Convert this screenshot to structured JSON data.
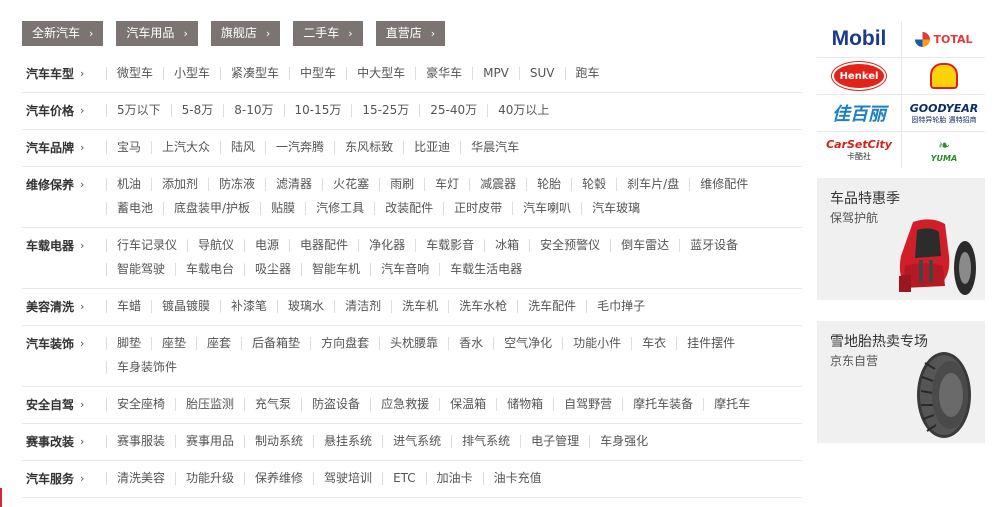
{
  "topnav": [
    {
      "label": "全新汽车"
    },
    {
      "label": "汽车用品"
    },
    {
      "label": "旗舰店"
    },
    {
      "label": "二手车"
    },
    {
      "label": "直营店"
    }
  ],
  "categories": [
    {
      "title": "汽车车型",
      "items": [
        "微型车",
        "小型车",
        "紧凑型车",
        "中型车",
        "中大型车",
        "豪华车",
        "MPV",
        "SUV",
        "跑车"
      ]
    },
    {
      "title": "汽车价格",
      "items": [
        "5万以下",
        "5-8万",
        "8-10万",
        "10-15万",
        "15-25万",
        "25-40万",
        "40万以上"
      ]
    },
    {
      "title": "汽车品牌",
      "items": [
        "宝马",
        "上汽大众",
        "陆风",
        "一汽奔腾",
        "东风标致",
        "比亚迪",
        "华晨汽车"
      ]
    },
    {
      "title": "维修保养",
      "items": [
        "机油",
        "添加剂",
        "防冻液",
        "滤清器",
        "火花塞",
        "雨刷",
        "车灯",
        "减震器",
        "轮胎",
        "轮毂",
        "刹车片/盘",
        "维修配件",
        "蓄电池",
        "底盘装甲/护板",
        "贴膜",
        "汽修工具",
        "改装配件",
        "正时皮带",
        "汽车喇叭",
        "汽车玻璃"
      ]
    },
    {
      "title": "车载电器",
      "items": [
        "行车记录仪",
        "导航仪",
        "电源",
        "电器配件",
        "净化器",
        "车载影音",
        "冰箱",
        "安全预警仪",
        "倒车雷达",
        "蓝牙设备",
        "智能驾驶",
        "车载电台",
        "吸尘器",
        "智能车机",
        "汽车音响",
        "车载生活电器"
      ]
    },
    {
      "title": "美容清洗",
      "items": [
        "车蜡",
        "镀晶镀膜",
        "补漆笔",
        "玻璃水",
        "清洁剂",
        "洗车机",
        "洗车水枪",
        "洗车配件",
        "毛巾掸子"
      ]
    },
    {
      "title": "汽车装饰",
      "items": [
        "脚垫",
        "座垫",
        "座套",
        "后备箱垫",
        "方向盘套",
        "头枕腰靠",
        "香水",
        "空气净化",
        "功能小件",
        "车衣",
        "挂件摆件",
        "车身装饰件"
      ]
    },
    {
      "title": "安全自驾",
      "items": [
        "安全座椅",
        "胎压监测",
        "充气泵",
        "防盗设备",
        "应急救援",
        "保温箱",
        "储物箱",
        "自驾野营",
        "摩托车装备",
        "摩托车"
      ]
    },
    {
      "title": "赛事改装",
      "items": [
        "赛事服装",
        "赛事用品",
        "制动系统",
        "悬挂系统",
        "进气系统",
        "排气系统",
        "电子管理",
        "车身强化"
      ]
    },
    {
      "title": "汽车服务",
      "items": [
        "清洗美容",
        "功能升级",
        "保养维修",
        "驾驶培训",
        "ETC",
        "加油卡",
        "油卡充值"
      ]
    }
  ],
  "brands": {
    "mobil": "Mobil",
    "total": "TOTAL",
    "henkel": "Henkel",
    "jiabaili": "佳百丽",
    "goodyear_en": "GOODYEAR",
    "goodyear_cn": "固特异轮胎 遇特招商",
    "carsetcity_en": "CarSetCity",
    "carsetcity_cn": "卡酷社",
    "yuma": "YUMA"
  },
  "promos": [
    {
      "title": "车品特惠季",
      "subtitle": "保驾护航"
    },
    {
      "title": "雪地胎热卖专场",
      "subtitle": "京东自营"
    }
  ],
  "colors": {
    "pill": "#7c7473",
    "accent": "#d4283b",
    "promo_bg": "#f0f0f0"
  }
}
